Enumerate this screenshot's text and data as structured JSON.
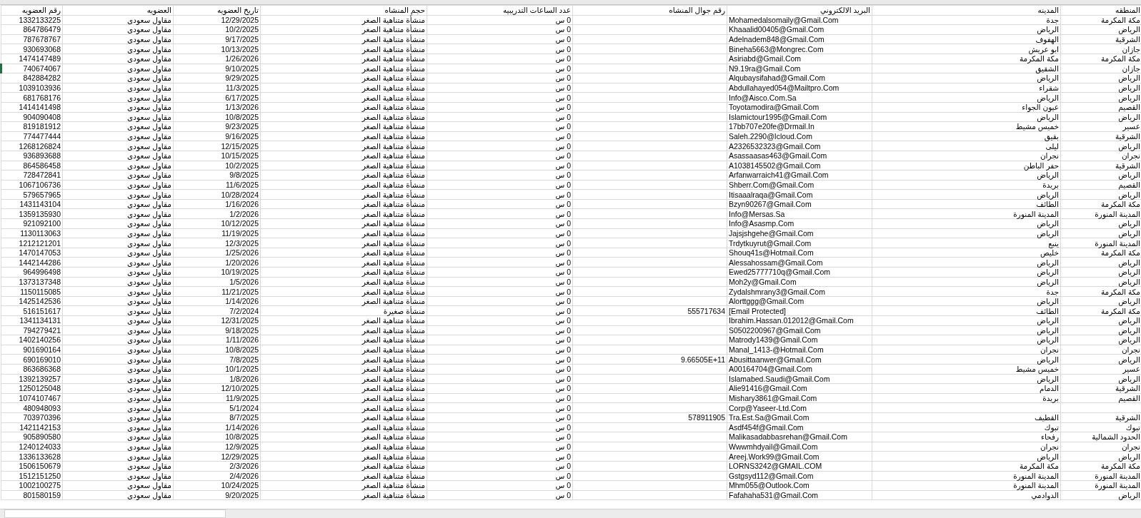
{
  "sheet": {
    "columns": [
      "المنطقه",
      "المدينه",
      "البريد الالكتروني",
      "رقم جوال المنشاه",
      "عدد الساعات التدريبيه",
      "حجم المنشاه",
      "تاريخ العضويه",
      "العضويه",
      "رقم العضويه"
    ],
    "rows": [
      {
        "selected": false,
        "cells": [
          "مكة المكرمة",
          "جدة",
          "Mohamedalsomaily@Gmail.Com",
          null,
          "0 س",
          "منشأة متناهية الصغر",
          "12/29/2025",
          "مقاول سعودى",
          "1332133225"
        ]
      },
      {
        "selected": false,
        "cells": [
          "الرياض",
          "الرياض",
          "Khaaalid00405@Gmail.Com",
          null,
          "0 س",
          "منشأة متناهية الصغر",
          "10/2/2025",
          "مقاول سعودى",
          "864786479"
        ]
      },
      {
        "selected": false,
        "cells": [
          "الشرقية",
          "الهفوف",
          "Adelnadem848@Gmail.Com",
          null,
          "0 س",
          "منشأة متناهية الصغر",
          "9/17/2025",
          "مقاول سعودى",
          "787678767"
        ]
      },
      {
        "selected": false,
        "cells": [
          "جازان",
          "ابو عريش",
          "Bineha5663@Mongrec.Com",
          null,
          "0 س",
          "منشأة متناهية الصغر",
          "10/13/2025",
          "مقاول سعودى",
          "930693068"
        ]
      },
      {
        "selected": false,
        "cells": [
          "مكة المكرمة",
          "مكة المكرمة",
          "Asiriabd@Gmail.Com",
          null,
          "0 س",
          "منشأة متناهية الصغر",
          "1/26/2026",
          "مقاول سعودى",
          "1474147489"
        ]
      },
      {
        "selected": true,
        "cells": [
          "جازان",
          "الشقيق",
          "N9.19ra@Gmail.Com",
          null,
          "0 س",
          "منشأة متناهية الصغر",
          "9/10/2025",
          "مقاول سعودى",
          "740674067"
        ]
      },
      {
        "selected": false,
        "cells": [
          "الرياض",
          "الرياض",
          "Alqubaysifahad@Gmail.Com",
          null,
          "0 س",
          "منشأة متناهية الصغر",
          "9/29/2025",
          "مقاول سعودى",
          "842884282"
        ]
      },
      {
        "selected": false,
        "cells": [
          "الرياض",
          "شقراء",
          "Abdullahayed054@Mailtpro.Com",
          null,
          "0 س",
          "منشأة متناهية الصغر",
          "11/3/2025",
          "مقاول سعودى",
          "1039103936"
        ]
      },
      {
        "selected": false,
        "cells": [
          "الرياض",
          "الرياض",
          "Info@Aisco.Com.Sa",
          null,
          "0 س",
          "منشأة متناهية الصغر",
          "6/17/2025",
          "مقاول سعودى",
          "681768176"
        ]
      },
      {
        "selected": false,
        "cells": [
          "القصيم",
          "عيون الجواء",
          "Toyotamodira@Gmail.Com",
          null,
          "0 س",
          "منشأة متناهية الصغر",
          "1/13/2026",
          "مقاول سعودى",
          "1414141498"
        ]
      },
      {
        "selected": false,
        "cells": [
          "الرياض",
          "الرياض",
          "Islamictour1995@Gmail.Com",
          null,
          "0 س",
          "منشأة متناهية الصغر",
          "10/8/2025",
          "مقاول سعودى",
          "904090408"
        ]
      },
      {
        "selected": false,
        "cells": [
          "عسير",
          "خميس مشيط",
          "17bb707e20fe@Drmail.In",
          null,
          "0 س",
          "منشأة متناهية الصغر",
          "9/23/2025",
          "مقاول سعودى",
          "819181912"
        ]
      },
      {
        "selected": false,
        "cells": [
          "الشرقية",
          "بقيق",
          "Saleh.2290@Icloud.Com",
          null,
          "0 س",
          "منشأة متناهية الصغر",
          "9/16/2025",
          "مقاول سعودى",
          "774477444"
        ]
      },
      {
        "selected": false,
        "cells": [
          "الرياض",
          "ليلى",
          "A2326532323@Gmail.Com",
          null,
          "0 س",
          "منشأة متناهية الصغر",
          "12/15/2025",
          "مقاول سعودى",
          "1268126824"
        ]
      },
      {
        "selected": false,
        "cells": [
          "نجران",
          "نجران",
          "Asassaasas463@Gmail.Com",
          null,
          "0 س",
          "منشأة متناهية الصغر",
          "10/15/2025",
          "مقاول سعودى",
          "936893688"
        ]
      },
      {
        "selected": false,
        "cells": [
          "الشرقية",
          "حفر الباطن",
          "A1038145502@Gmail.Com",
          null,
          "0 س",
          "منشأة متناهية الصغر",
          "10/2/2025",
          "مقاول سعودى",
          "864586458"
        ]
      },
      {
        "selected": false,
        "cells": [
          "الرياض",
          "الرياض",
          "Arfanwarraich41@Gmail.Com",
          null,
          "0 س",
          "منشأة متناهية الصغر",
          "9/8/2025",
          "مقاول سعودى",
          "728472841"
        ]
      },
      {
        "selected": false,
        "cells": [
          "القصيم",
          "بريدة",
          "Shberr.Com@Gmail.Com",
          null,
          "0 س",
          "منشأة متناهية الصغر",
          "11/6/2025",
          "مقاول سعودى",
          "1067106736"
        ]
      },
      {
        "selected": false,
        "cells": [
          "الرياض",
          "الرياض",
          "Itisaaalraqa@Gmail.Com",
          null,
          "0 س",
          "منشأة متناهية الصغر",
          "10/28/2024",
          "مقاول سعودى",
          "579657965"
        ]
      },
      {
        "selected": false,
        "cells": [
          "مكة المكرمة",
          "الطائف",
          "Bzyn90267@Gmail.Com",
          null,
          "0 س",
          "منشأة متناهية الصغر",
          "1/16/2026",
          "مقاول سعودى",
          "1431143104"
        ]
      },
      {
        "selected": false,
        "cells": [
          "المدينة المنورة",
          "المدينة المنورة",
          "Info@Mersas.Sa",
          null,
          "0 س",
          "منشأة متناهية الصغر",
          "1/2/2026",
          "مقاول سعودى",
          "1359135930"
        ]
      },
      {
        "selected": false,
        "cells": [
          "الرياض",
          "الرياض",
          "Info@Asasmp.Com",
          null,
          "0 س",
          "منشأة متناهية الصغر",
          "10/12/2025",
          "مقاول سعودى",
          "921092100"
        ]
      },
      {
        "selected": false,
        "cells": [
          "الرياض",
          "الرياض",
          "Jajsjshgehe@Gmail.Com",
          null,
          "0 س",
          "منشأة متناهية الصغر",
          "11/19/2025",
          "مقاول سعودى",
          "1130113063"
        ]
      },
      {
        "selected": false,
        "cells": [
          "المدينة المنورة",
          "ينبع",
          "Trdytkuyrut@Gmail.Com",
          null,
          "0 س",
          "منشأة متناهية الصغر",
          "12/3/2025",
          "مقاول سعودى",
          "1212121201"
        ]
      },
      {
        "selected": false,
        "cells": [
          "مكة المكرمة",
          "خليص",
          "Shouq41s@Hotmail.Com",
          null,
          "0 س",
          "منشأة متناهية الصغر",
          "1/25/2026",
          "مقاول سعودى",
          "1470147053"
        ]
      },
      {
        "selected": false,
        "cells": [
          "الرياض",
          "الرياض",
          "Alessahossam@Gmail.Com",
          null,
          "0 س",
          "منشأة متناهية الصغر",
          "1/20/2026",
          "مقاول سعودى",
          "1442144286"
        ]
      },
      {
        "selected": false,
        "cells": [
          "الرياض",
          "الرياض",
          "Ewed25777710q@Gmail.Com",
          null,
          "0 س",
          "منشأة متناهية الصغر",
          "10/19/2025",
          "مقاول سعودى",
          "964996498"
        ]
      },
      {
        "selected": false,
        "cells": [
          "الرياض",
          "الرياض",
          "Moh2y@Gmail.Com",
          null,
          "0 س",
          "منشأة متناهية الصغر",
          "1/5/2026",
          "مقاول سعودى",
          "1373137348"
        ]
      },
      {
        "selected": false,
        "cells": [
          "مكة المكرمة",
          "جدة",
          "Zydalshmrany3@Gmail.Com",
          null,
          "0 س",
          "منشأة متناهية الصغر",
          "11/21/2025",
          "مقاول سعودى",
          "1150115085"
        ]
      },
      {
        "selected": false,
        "cells": [
          "الرياض",
          "الرياض",
          "Alorttggg@Gmail.Com",
          null,
          "0 س",
          "منشأة متناهية الصغر",
          "1/14/2026",
          "مقاول سعودى",
          "1425142536"
        ]
      },
      {
        "selected": false,
        "cells": [
          "مكة المكرمة",
          "الطائف",
          "[Email Protected]",
          "555717634",
          "0 س",
          "منشأة صغيرة",
          "7/2/2024",
          "مقاول سعودى",
          "516151617"
        ]
      },
      {
        "selected": false,
        "cells": [
          "الرياض",
          "الرياض",
          "Ibrahim.Hassan.012012@Gmail.Com",
          null,
          "0 س",
          "منشأة متناهية الصغر",
          "12/31/2025",
          "مقاول سعودى",
          "1341134131"
        ]
      },
      {
        "selected": false,
        "cells": [
          "الرياض",
          "الرياض",
          "S0502200967@Gmail.Com",
          null,
          "0 س",
          "منشأة متناهية الصغر",
          "9/18/2025",
          "مقاول سعودى",
          "794279421"
        ]
      },
      {
        "selected": false,
        "cells": [
          "الرياض",
          "الرياض",
          "Matrody1439@Gmail.Com",
          null,
          "0 س",
          "منشأة متناهية الصغر",
          "1/11/2026",
          "مقاول سعودى",
          "1402140256"
        ]
      },
      {
        "selected": false,
        "cells": [
          "نجران",
          "نجران",
          "Manal_1413-@Hotmail.Com",
          null,
          "0 س",
          "منشأة متناهية الصغر",
          "10/8/2025",
          "مقاول سعودى",
          "901690164"
        ]
      },
      {
        "selected": false,
        "cells": [
          "الرياض",
          "الرياض",
          "Abusittaanwer@Gmail.Com",
          "9.66505E+11",
          "0 س",
          "منشأة متناهية الصغر",
          "7/8/2025",
          "مقاول سعودى",
          "690169010"
        ]
      },
      {
        "selected": false,
        "cells": [
          "عسير",
          "خميس مشيط",
          "A00164704@Gmail.Com",
          null,
          "0 س",
          "منشأة متناهية الصغر",
          "10/1/2025",
          "مقاول سعودى",
          "863686368"
        ]
      },
      {
        "selected": false,
        "cells": [
          "الرياض",
          "الرياض",
          "Islamabed.Saudi@Gmail.Com",
          null,
          "0 س",
          "منشأة متناهية الصغر",
          "1/8/2026",
          "مقاول سعودى",
          "1392139257"
        ]
      },
      {
        "selected": false,
        "cells": [
          "الشرقية",
          "الدمام",
          "Alie91416@Gmail.Com",
          null,
          "0 س",
          "منشأة متناهية الصغر",
          "12/10/2025",
          "مقاول سعودى",
          "1250125048"
        ]
      },
      {
        "selected": false,
        "cells": [
          "القصيم",
          "بريدة",
          "Mishary3861@Gmail.Com",
          null,
          "0 س",
          "منشأة متناهية الصغر",
          "11/9/2025",
          "مقاول سعودى",
          "1074107467"
        ]
      },
      {
        "selected": false,
        "cells": [
          null,
          null,
          "Corp@Yaseer-Ltd.Com",
          null,
          "0 س",
          "منشأة متناهية الصغر",
          "5/1/2024",
          "مقاول سعودى",
          "480948093"
        ]
      },
      {
        "selected": false,
        "cells": [
          "الشرقية",
          "القطيف",
          "Tra.Est.Sa@Gmail.Com",
          "578911905",
          "0 س",
          "منشأة متناهية الصغر",
          "8/7/2025",
          "مقاول سعودى",
          "703970396"
        ]
      },
      {
        "selected": false,
        "cells": [
          "تبوك",
          "تبوك",
          "Asdf454f@Gmail.Com",
          null,
          "0 س",
          "منشأة متناهية الصغر",
          "1/14/2026",
          "مقاول سعودى",
          "1421142153"
        ]
      },
      {
        "selected": false,
        "cells": [
          "الحدود الشمالية",
          "رفحاء",
          "Malikasadabbasrehan@Gmail.Com",
          null,
          "0 س",
          "منشأة متناهية الصغر",
          "10/8/2025",
          "مقاول سعودى",
          "905890580"
        ]
      },
      {
        "selected": false,
        "cells": [
          "نجران",
          "نجران",
          "Wwwmhdyail@Gmail.Com",
          null,
          "0 س",
          "منشأة متناهية الصغر",
          "12/9/2025",
          "مقاول سعودى",
          "1240124033"
        ]
      },
      {
        "selected": false,
        "cells": [
          "الرياض",
          "الرياض",
          "Areej.Work99@Gmail.Com",
          null,
          "0 س",
          "منشأة متناهية الصغر",
          "12/29/2025",
          "مقاول سعودى",
          "1336133628"
        ]
      },
      {
        "selected": false,
        "cells": [
          "مكة المكرمة",
          "مكة المكرمة",
          "LORNS3242@GMAIL.COM",
          null,
          "0 س",
          "منشأة متناهية الصغر",
          "2/3/2026",
          "مقاول سعودى",
          "1506150679"
        ]
      },
      {
        "selected": false,
        "cells": [
          "المدينة المنورة",
          "المدينة المنورة",
          "Gstgsyd112@Gmail.Com",
          null,
          "0 س",
          "منشأة متناهية الصغر",
          "2/4/2026",
          "مقاول سعودى",
          "1512151250"
        ]
      },
      {
        "selected": false,
        "cells": [
          "المدينة المنورة",
          "المدينة المنورة",
          "Mhm055@Outlook.Com",
          null,
          "0 س",
          "منشأة متناهية الصغر",
          "10/24/2025",
          "مقاول سعودى",
          "1002100275"
        ]
      },
      {
        "selected": false,
        "cells": [
          "الرياض",
          "الدوادمي",
          "Fafahaha531@Gmail.Com",
          null,
          "0 س",
          "منشأة متناهية الصغر",
          "9/20/2025",
          "مقاول سعودى",
          "801580159"
        ]
      }
    ]
  }
}
